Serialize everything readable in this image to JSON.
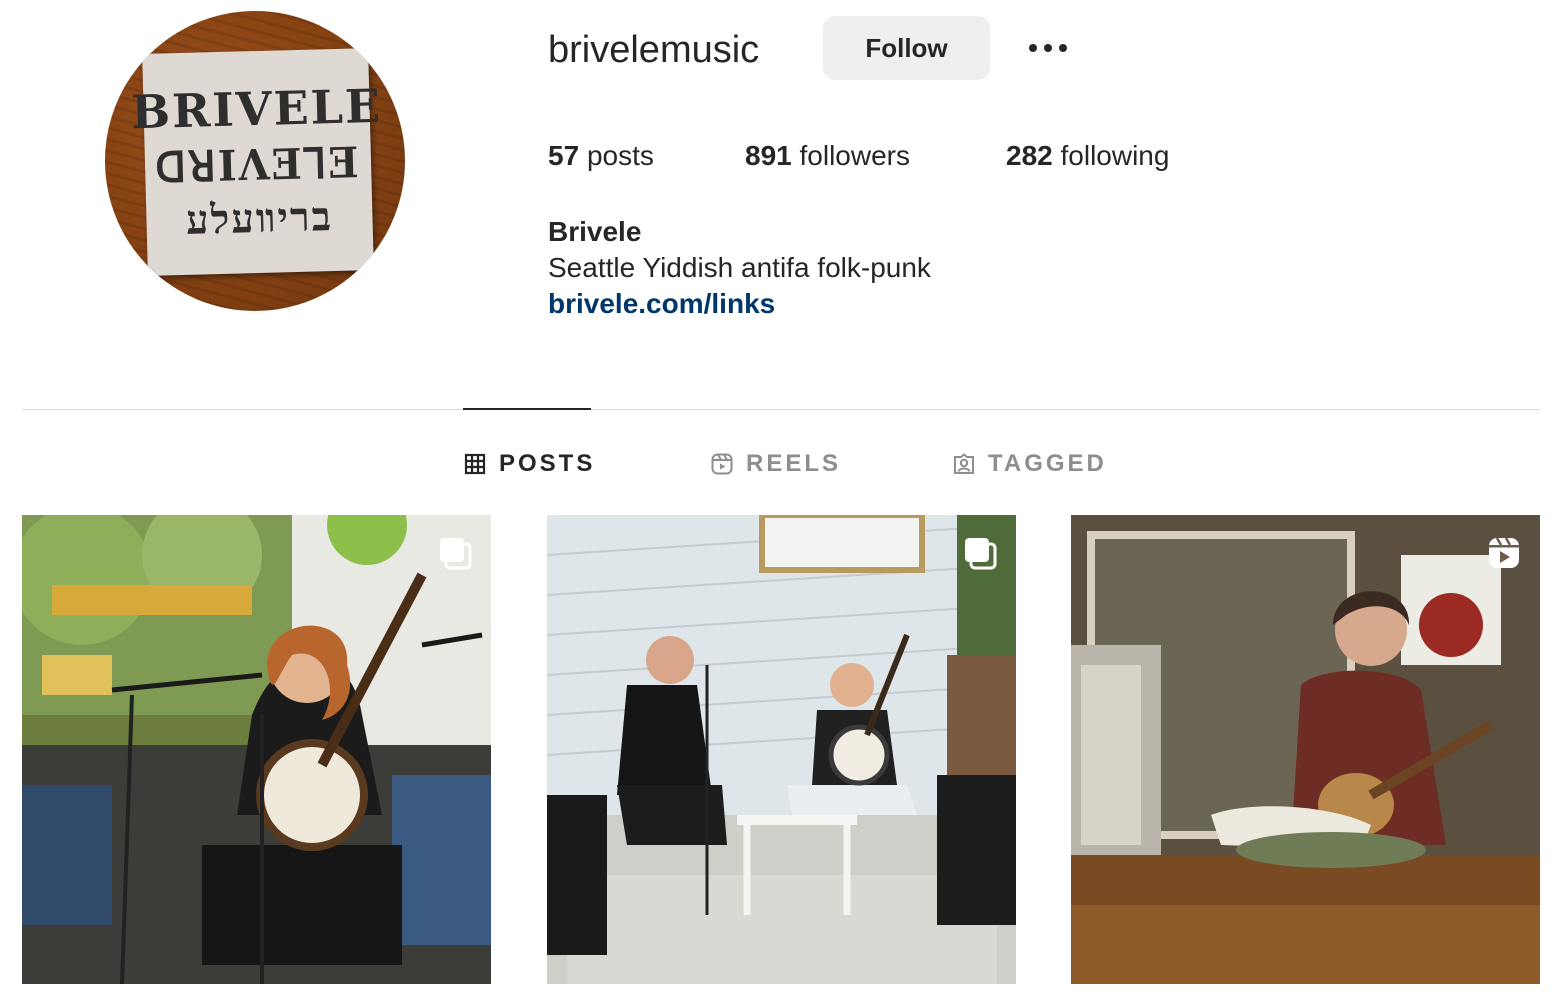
{
  "profile": {
    "username": "brivelemusic",
    "avatar_lines": [
      "BRIVELE",
      "ᗡꓤIΛƎꓶƎ",
      "בריװעלע"
    ]
  },
  "header": {
    "follow_label": "Follow",
    "more_icon": "more-horizontal-icon"
  },
  "stats": {
    "posts_count": "57",
    "posts_label": "posts",
    "followers_count": "891",
    "followers_label": "followers",
    "following_count": "282",
    "following_label": "following"
  },
  "bio": {
    "name": "Brivele",
    "text": "Seattle Yiddish antifa folk-punk",
    "link": "brivele.com/links"
  },
  "tabs": [
    {
      "label": "POSTS",
      "icon": "grid-icon",
      "active": true
    },
    {
      "label": "REELS",
      "icon": "reels-icon",
      "active": false
    },
    {
      "label": "TAGGED",
      "icon": "tagged-icon",
      "active": false
    }
  ],
  "posts": [
    {
      "badge": "carousel-icon"
    },
    {
      "badge": "carousel-icon"
    },
    {
      "badge": "reel-icon"
    }
  ],
  "colors": {
    "link": "#00376b",
    "button_bg": "#efefef",
    "text": "#262626",
    "muted": "#8e8e8e",
    "divider": "#dbdbdb"
  }
}
